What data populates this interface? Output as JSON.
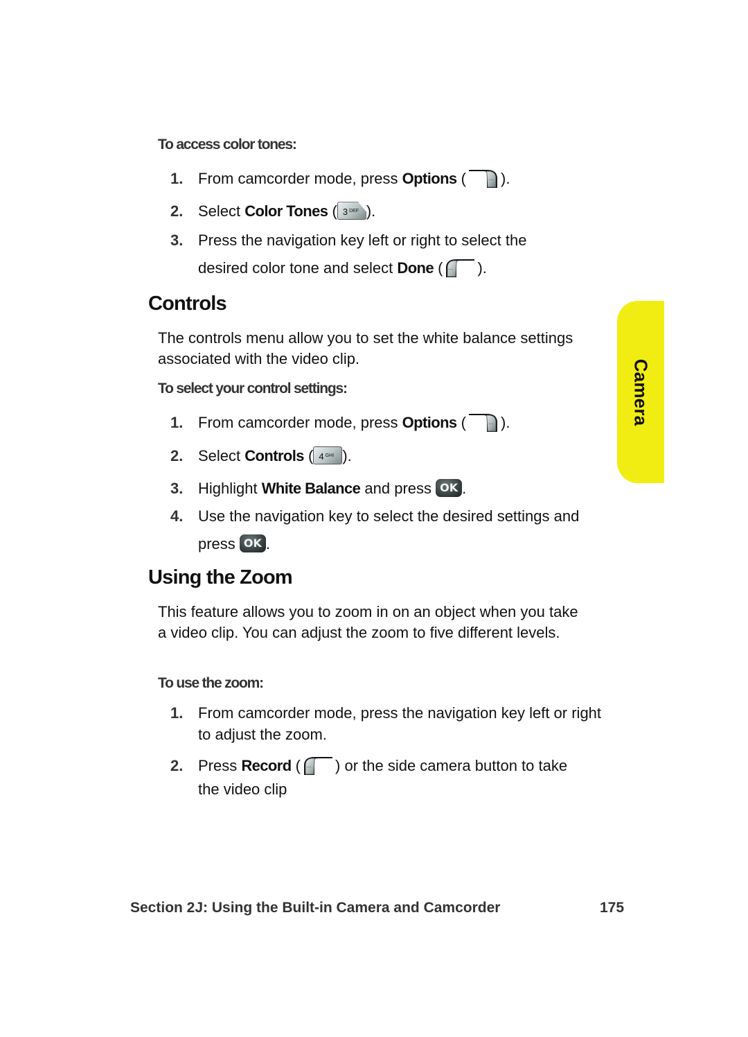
{
  "color_tones": {
    "subheading": "To access color tones:",
    "steps": [
      {
        "num": "1.",
        "pre": "From camcorder mode, press ",
        "bold": "Options",
        "open": " (",
        "close": ")."
      },
      {
        "num": "2.",
        "pre": "Select ",
        "bold": "Color Tones",
        "open": " (",
        "close": ")."
      },
      {
        "num": "3.",
        "line1": "Press the navigation key left or right to select the",
        "pre": "desired color tone and select ",
        "bold": "Done",
        "open": " (",
        "close": ")."
      }
    ],
    "keys": {
      "options_icon": "right-softkey-icon",
      "color_tones_key": {
        "digit": "3",
        "letters": "DEF"
      },
      "done_icon": "left-softkey-icon"
    }
  },
  "controls": {
    "heading": "Controls",
    "intro": "The controls menu allow you to set the white balance settings associated with the video clip.",
    "subheading": "To select your control settings:",
    "steps": [
      {
        "num": "1.",
        "pre": "From camcorder mode, press ",
        "bold": "Options",
        "open": " (",
        "close": ")."
      },
      {
        "num": "2.",
        "pre": "Select ",
        "bold": "Controls",
        "open": " (",
        "close": ")."
      },
      {
        "num": "3.",
        "pre": "Highlight ",
        "bold": "White Balance",
        "post": " and press ",
        "close": "."
      },
      {
        "num": "4.",
        "line1": "Use the navigation key to select the desired settings and",
        "pre": "press ",
        "close": "."
      }
    ],
    "keys": {
      "controls_key": {
        "digit": "4",
        "letters": "GHI"
      },
      "ok_label": "OK"
    }
  },
  "zoom": {
    "heading": "Using the Zoom",
    "intro": "This feature allows you to zoom in on an object when you take a video clip. You can adjust the zoom to five different levels.",
    "subheading": "To use the zoom:",
    "steps": [
      {
        "num": "1.",
        "text": "From camcorder mode, press the navigation key left or right to adjust the zoom."
      },
      {
        "num": "2.",
        "pre": "Press ",
        "bold": "Record",
        "open": " (",
        "post": ") or the side camera button to take",
        "line2": "the video clip"
      }
    ]
  },
  "side_tab": {
    "label": "Camera",
    "color": "#f1ed12"
  },
  "footer": {
    "section": "Section 2J: Using the Built-in Camera and Camcorder",
    "page": "175"
  }
}
